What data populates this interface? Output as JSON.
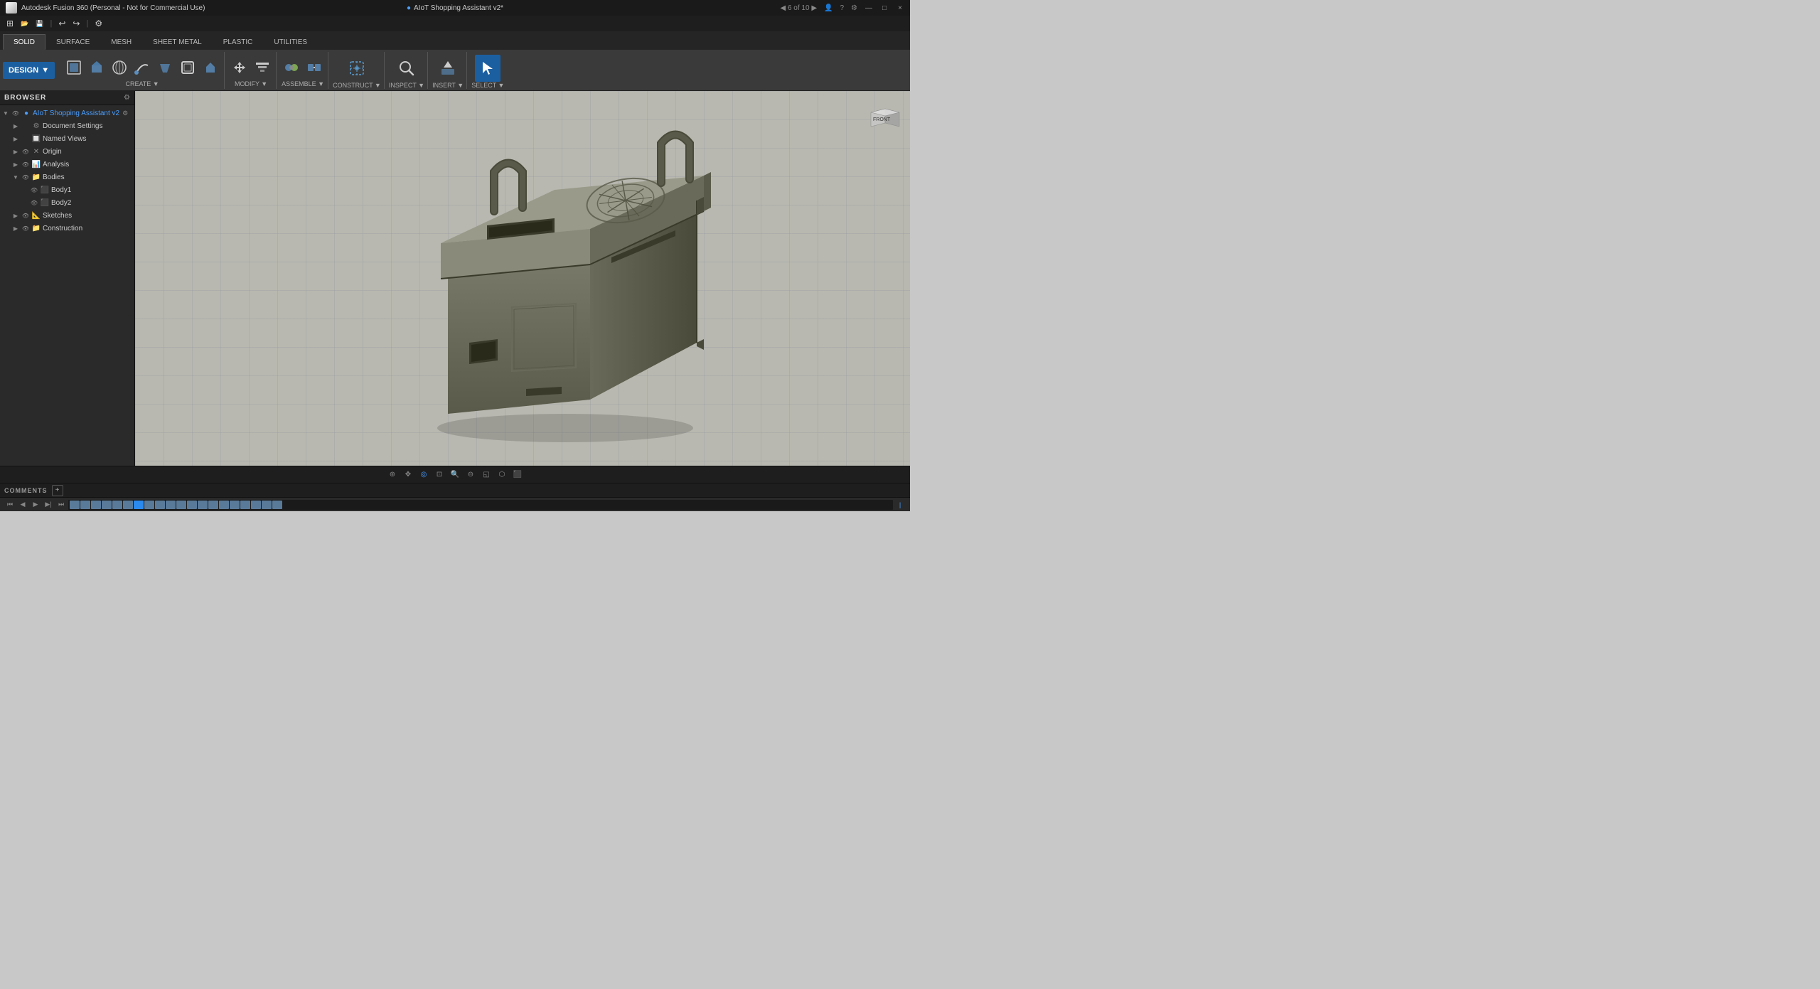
{
  "titlebar": {
    "app_name": "Autodesk Fusion 360 (Personal - Not for Commercial Use)",
    "doc_title": "AIoT Shopping Assistant v2*",
    "close": "×",
    "minimize": "—",
    "maximize": "□"
  },
  "quicktoolbar": {
    "buttons": [
      "⊞",
      "↩",
      "↪",
      "▶",
      "⚙"
    ]
  },
  "tabs": {
    "items": [
      "SOLID",
      "SURFACE",
      "MESH",
      "SHEET METAL",
      "PLASTIC",
      "UTILITIES"
    ],
    "active": "SOLID"
  },
  "design_dropdown": {
    "label": "DESIGN",
    "arrow": "▼"
  },
  "toolbar_sections": [
    {
      "label": "CREATE ▼",
      "tools": [
        {
          "icon": "⬜",
          "label": ""
        },
        {
          "icon": "⬛",
          "label": ""
        },
        {
          "icon": "◎",
          "label": ""
        },
        {
          "icon": "⬡",
          "label": ""
        },
        {
          "icon": "⬜",
          "label": ""
        },
        {
          "icon": "◼",
          "label": ""
        },
        {
          "icon": "⬛",
          "label": ""
        }
      ]
    },
    {
      "label": "MODIFY ▼",
      "tools": [
        {
          "icon": "✥",
          "label": ""
        },
        {
          "icon": "⤢",
          "label": ""
        }
      ]
    },
    {
      "label": "ASSEMBLE ▼",
      "tools": [
        {
          "icon": "⚙",
          "label": ""
        },
        {
          "icon": "🔗",
          "label": ""
        }
      ]
    },
    {
      "label": "CONSTRUCT ▼",
      "tools": [
        {
          "icon": "⊕",
          "label": ""
        }
      ]
    },
    {
      "label": "INSPECT ▼",
      "tools": [
        {
          "icon": "🔍",
          "label": ""
        }
      ]
    },
    {
      "label": "INSERT ▼",
      "tools": [
        {
          "icon": "↓",
          "label": ""
        }
      ]
    },
    {
      "label": "SELECT ▼",
      "tools": [
        {
          "icon": "↖",
          "label": ""
        }
      ]
    }
  ],
  "browser": {
    "title": "BROWSER",
    "items": [
      {
        "label": "AIoT Shopping Assistant v2",
        "indent": 0,
        "type": "root",
        "expanded": true
      },
      {
        "label": "Document Settings",
        "indent": 1,
        "type": "settings"
      },
      {
        "label": "Named Views",
        "indent": 1,
        "type": "views"
      },
      {
        "label": "Origin",
        "indent": 1,
        "type": "origin"
      },
      {
        "label": "Analysis",
        "indent": 1,
        "type": "analysis"
      },
      {
        "label": "Bodies",
        "indent": 1,
        "type": "folder",
        "expanded": true
      },
      {
        "label": "Body1",
        "indent": 2,
        "type": "body"
      },
      {
        "label": "Body2",
        "indent": 2,
        "type": "body"
      },
      {
        "label": "Sketches",
        "indent": 1,
        "type": "sketches"
      },
      {
        "label": "Construction",
        "indent": 1,
        "type": "construction"
      }
    ]
  },
  "viewport": {
    "background_color": "#b4b4ac"
  },
  "cube": {
    "face": "FRONT"
  },
  "statusbar": {
    "icons": [
      "⊕",
      "◎",
      "🔍",
      "⊖",
      "◱",
      "⬡",
      "⬛"
    ]
  },
  "comments": {
    "label": "COMMENTS",
    "add_label": "+"
  },
  "timeline": {
    "nav_buttons": [
      "⏮",
      "⏴",
      "▶",
      "⏵",
      "⏭"
    ]
  }
}
